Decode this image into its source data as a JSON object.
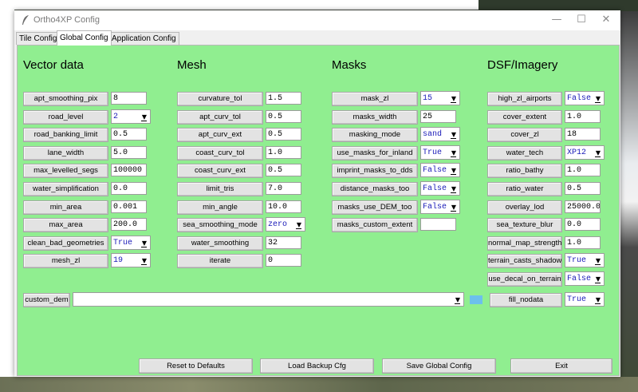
{
  "window": {
    "title": "Ortho4XP Config",
    "controls": {
      "minimize": "—",
      "maximize": "☐",
      "close": "✕"
    }
  },
  "tabs": [
    {
      "label": "Tile Config",
      "active": false
    },
    {
      "label": "Global Config",
      "active": true
    },
    {
      "label": "Application Config",
      "active": false
    }
  ],
  "sections": {
    "vector": {
      "title": "Vector data",
      "rows": [
        {
          "label": "apt_smoothing_pix",
          "value": "8",
          "kind": "entry"
        },
        {
          "label": "road_level",
          "value": "2",
          "kind": "combo"
        },
        {
          "label": "road_banking_limit",
          "value": "0.5",
          "kind": "entry"
        },
        {
          "label": "lane_width",
          "value": "5.0",
          "kind": "entry"
        },
        {
          "label": "max_levelled_segs",
          "value": "100000",
          "kind": "entry"
        },
        {
          "label": "water_simplification",
          "value": "0.0",
          "kind": "entry"
        },
        {
          "label": "min_area",
          "value": "0.001",
          "kind": "entry"
        },
        {
          "label": "max_area",
          "value": "200.0",
          "kind": "entry"
        },
        {
          "label": "clean_bad_geometries",
          "value": "True",
          "kind": "combo"
        },
        {
          "label": "mesh_zl",
          "value": "19",
          "kind": "combo"
        }
      ]
    },
    "mesh": {
      "title": "Mesh",
      "rows": [
        {
          "label": "curvature_tol",
          "value": "1.5",
          "kind": "entry"
        },
        {
          "label": "apt_curv_tol",
          "value": "0.5",
          "kind": "entry"
        },
        {
          "label": "apt_curv_ext",
          "value": "0.5",
          "kind": "entry"
        },
        {
          "label": "coast_curv_tol",
          "value": "1.0",
          "kind": "entry"
        },
        {
          "label": "coast_curv_ext",
          "value": "0.5",
          "kind": "entry"
        },
        {
          "label": "limit_tris",
          "value": "7.0",
          "kind": "entry"
        },
        {
          "label": "min_angle",
          "value": "10.0",
          "kind": "entry"
        },
        {
          "label": "sea_smoothing_mode",
          "value": "zero",
          "kind": "combo"
        },
        {
          "label": "water_smoothing",
          "value": "32",
          "kind": "entry"
        },
        {
          "label": "iterate",
          "value": "0",
          "kind": "entry"
        }
      ]
    },
    "masks": {
      "title": "Masks",
      "rows": [
        {
          "label": "mask_zl",
          "value": "15",
          "kind": "combo"
        },
        {
          "label": "masks_width",
          "value": "25",
          "kind": "entry"
        },
        {
          "label": "masking_mode",
          "value": "sand",
          "kind": "combo"
        },
        {
          "label": "use_masks_for_inland",
          "value": "True",
          "kind": "combo"
        },
        {
          "label": "imprint_masks_to_dds",
          "value": "False",
          "kind": "combo"
        },
        {
          "label": "distance_masks_too",
          "value": "False",
          "kind": "combo"
        },
        {
          "label": "masks_use_DEM_too",
          "value": "False",
          "kind": "combo"
        },
        {
          "label": "masks_custom_extent",
          "value": "",
          "kind": "entry"
        }
      ]
    },
    "dsf": {
      "title": "DSF/Imagery",
      "rows": [
        {
          "label": "high_zl_airports",
          "value": "False",
          "kind": "combo"
        },
        {
          "label": "cover_extent",
          "value": "1.0",
          "kind": "entry"
        },
        {
          "label": "cover_zl",
          "value": "18",
          "kind": "entry"
        },
        {
          "label": "water_tech",
          "value": "XP12",
          "kind": "combo"
        },
        {
          "label": "ratio_bathy",
          "value": "1.0",
          "kind": "entry"
        },
        {
          "label": "ratio_water",
          "value": "0.5",
          "kind": "entry"
        },
        {
          "label": "overlay_lod",
          "value": "25000.0",
          "kind": "entry"
        },
        {
          "label": "sea_texture_blur",
          "value": "0.0",
          "kind": "entry"
        },
        {
          "label": "normal_map_strength",
          "value": "1.0",
          "kind": "entry"
        },
        {
          "label": "terrain_casts_shadow",
          "value": "True",
          "kind": "combo"
        },
        {
          "label": "use_decal_on_terrain",
          "value": "False",
          "kind": "combo"
        }
      ]
    }
  },
  "custom_dem": {
    "label": "custom_dem",
    "value": ""
  },
  "fill_nodata": {
    "label": "fill_nodata",
    "value": "True"
  },
  "bottom_buttons": {
    "reset": "Reset to Defaults",
    "load": "Load Backup Cfg",
    "save": "Save Global Config",
    "exit": "Exit"
  },
  "colors": {
    "panel_bg": "#90ee90",
    "combo_text": "#1a1ab8",
    "swatch": "#6cc0ec"
  },
  "icons": {
    "app": "feather-icon",
    "dropdown": "chevron-down-icon"
  }
}
